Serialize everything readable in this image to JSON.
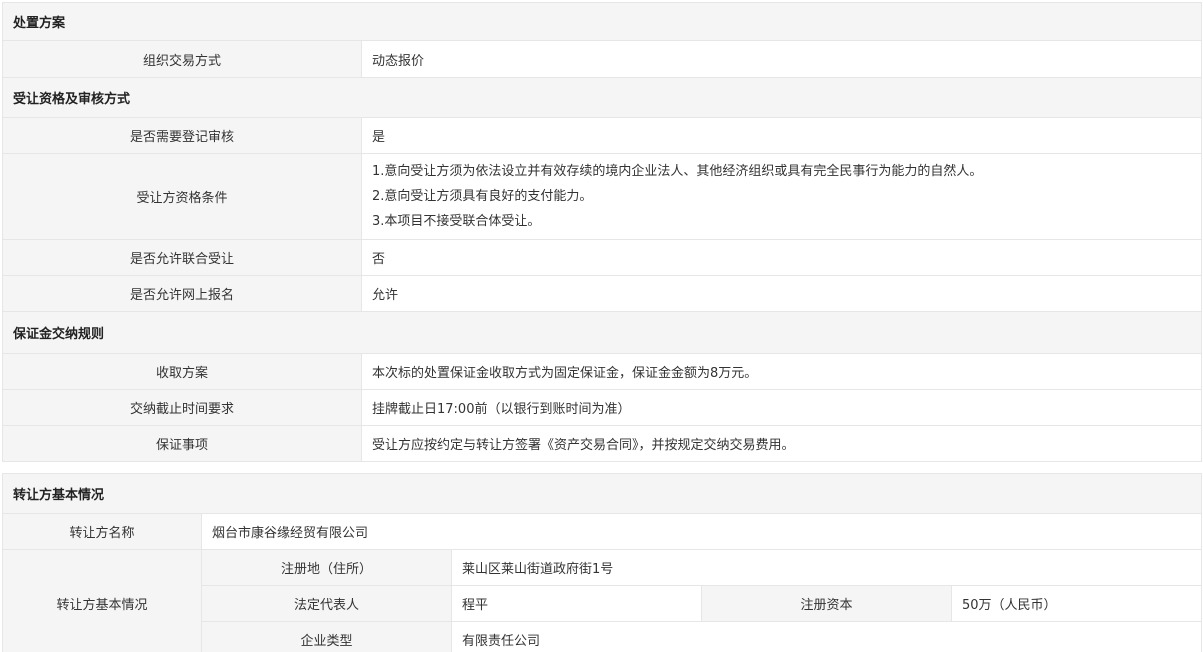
{
  "disposal": {
    "header": "处置方案",
    "rows": [
      {
        "label": "组织交易方式",
        "value": "动态报价"
      }
    ]
  },
  "qualification": {
    "header": "受让资格及审核方式",
    "register_review": {
      "label": "是否需要登记审核",
      "value": "是"
    },
    "conditions": {
      "label": "受让方资格条件",
      "lines": [
        "1.意向受让方须为依法设立并有效存续的境内企业法人、其他经济组织或具有完全民事行为能力的自然人。",
        "2.意向受让方须具有良好的支付能力。",
        "3.本项目不接受联合体受让。"
      ]
    },
    "joint": {
      "label": "是否允许联合受让",
      "value": "否"
    },
    "online": {
      "label": "是否允许网上报名",
      "value": "允许"
    }
  },
  "deposit": {
    "header": "保证金交纳规则",
    "scheme": {
      "label": "收取方案",
      "value": "本次标的处置保证金收取方式为固定保证金，保证金金额为8万元。"
    },
    "deadline": {
      "label": "交纳截止时间要求",
      "value": "挂牌截止日17:00前（以银行到账时间为准）"
    },
    "matters": {
      "label": "保证事项",
      "value": "受让方应按约定与转让方签署《资产交易合同》，并按规定交纳交易费用。"
    }
  },
  "transferor": {
    "header": "转让方基本情况",
    "name": {
      "label": "转让方名称",
      "value": "烟台市康谷缘经贸有限公司"
    },
    "basic_label": "转让方基本情况",
    "address": {
      "label": "注册地（住所）",
      "value": "莱山区莱山街道政府街1号"
    },
    "legal_rep": {
      "label": "法定代表人",
      "value": "程平"
    },
    "capital": {
      "label": "注册资本",
      "value": "50万（人民币）"
    },
    "company_type": {
      "label": "企业类型",
      "value": "有限责任公司"
    }
  }
}
